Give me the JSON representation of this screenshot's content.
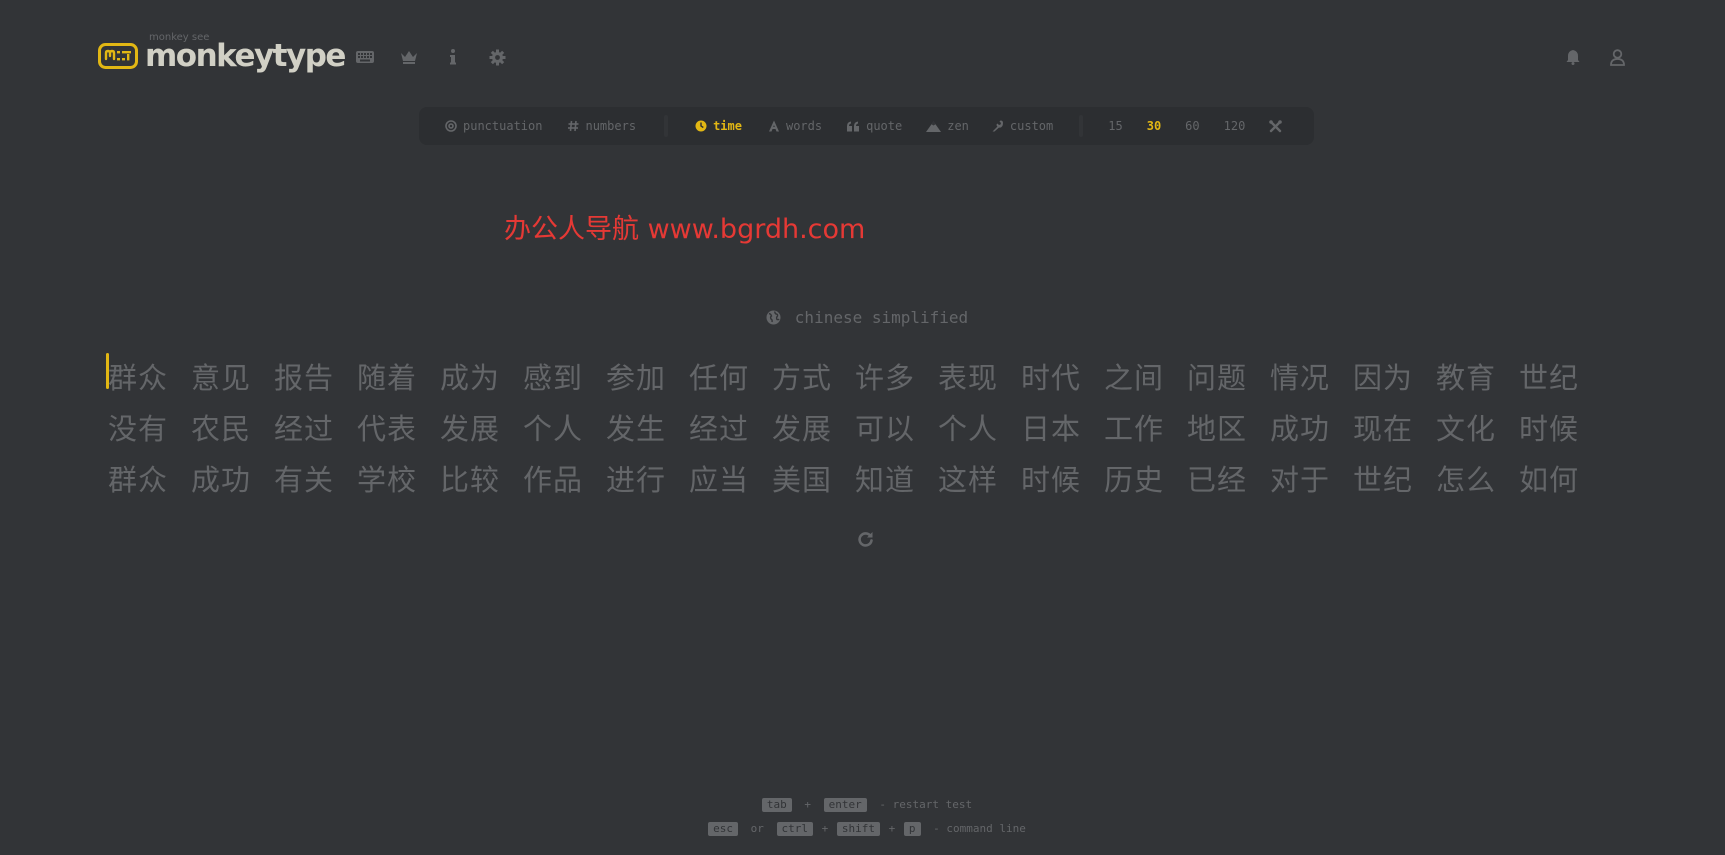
{
  "brand": {
    "name": "monkeytype",
    "subtitle": "monkey see"
  },
  "nav": {
    "icons": [
      "keyboard-icon",
      "crown-icon",
      "info-icon",
      "gear-icon"
    ],
    "right_icons": [
      "bell-icon",
      "user-icon"
    ]
  },
  "config": {
    "punctuation": "punctuation",
    "numbers": "numbers",
    "modes": [
      {
        "label": "time",
        "icon": "clock-icon",
        "active": true
      },
      {
        "label": "words",
        "icon": "font-icon",
        "active": false
      },
      {
        "label": "quote",
        "icon": "quote-icon",
        "active": false
      },
      {
        "label": "zen",
        "icon": "mountain-icon",
        "active": false
      },
      {
        "label": "custom",
        "icon": "wrench-icon",
        "active": false
      }
    ],
    "durations": [
      {
        "label": "15",
        "active": false
      },
      {
        "label": "30",
        "active": true
      },
      {
        "label": "60",
        "active": false
      },
      {
        "label": "120",
        "active": false
      }
    ]
  },
  "watermark": "办公人导航 www.bgrdh.com",
  "language": "chinese simplified",
  "words": [
    [
      "群众",
      "意见",
      "报告",
      "随着",
      "成为",
      "感到",
      "参加",
      "任何",
      "方式",
      "许多",
      "表现",
      "时代",
      "之间",
      "问题",
      "情况",
      "因为",
      "教育",
      "世纪"
    ],
    [
      "没有",
      "农民",
      "经过",
      "代表",
      "发展",
      "个人",
      "发生",
      "经过",
      "发展",
      "可以",
      "个人",
      "日本",
      "工作",
      "地区",
      "成功",
      "现在",
      "文化",
      "时候"
    ],
    [
      "群众",
      "成功",
      "有关",
      "学校",
      "比较",
      "作品",
      "进行",
      "应当",
      "美国",
      "知道",
      "这样",
      "时候",
      "历史",
      "已经",
      "对于",
      "世纪",
      "怎么",
      "如何"
    ]
  ],
  "footer": {
    "line1": {
      "key1": "tab",
      "plus": "+",
      "key2": "enter",
      "text": "- restart test"
    },
    "line2": {
      "key1": "esc",
      "or": "or",
      "key2": "ctrl",
      "plus1": "+",
      "key3": "shift",
      "plus2": "+",
      "key4": "p",
      "text": "- command line"
    }
  },
  "colors": {
    "background": "#323437",
    "sub_background": "#2c2e31",
    "accent": "#e2b714",
    "sub": "#646669",
    "text": "#d1d0c5",
    "watermark": "#e53935"
  }
}
